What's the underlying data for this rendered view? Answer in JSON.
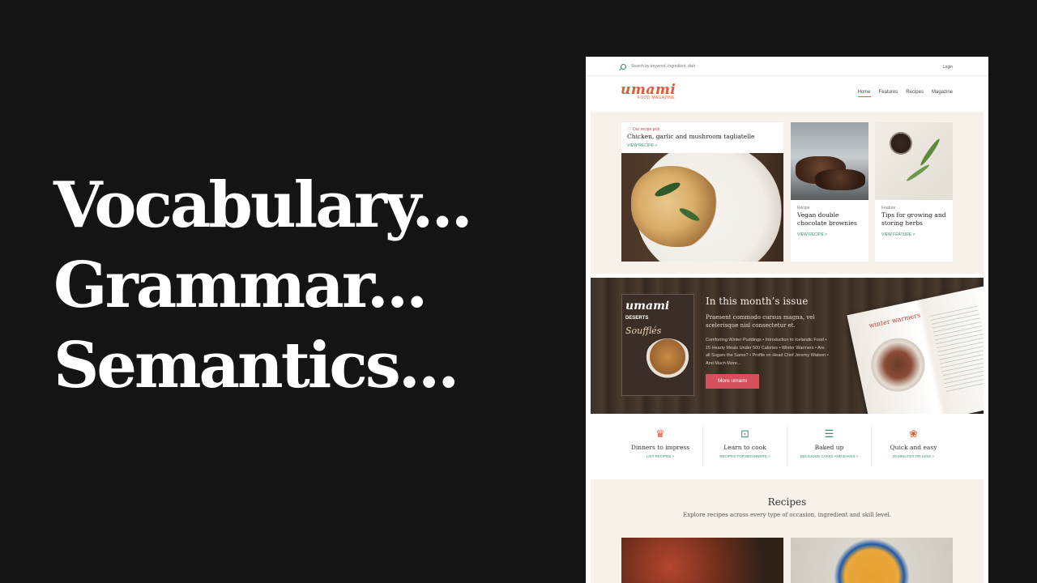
{
  "slide": {
    "lines": [
      "Vocabulary...",
      "Grammar...",
      "Semantics..."
    ]
  },
  "site": {
    "search_placeholder": "Search by keyword, ingredient, dish",
    "login": "Login",
    "logo": "umami",
    "logo_sub": "FOOD MAGAZINE",
    "nav": [
      "Home",
      "Features",
      "Recipes",
      "Magazine"
    ],
    "hero": {
      "pick_label": "Our recipe pick",
      "pick_title": "Chicken, garlic and mushroom tagliatelle",
      "pick_link": "VIEW RECIPE >",
      "cards": [
        {
          "kicker": "Recipe",
          "title": "Vegan double chocolate brownies",
          "link": "VIEW RECIPE >"
        },
        {
          "kicker": "Feature",
          "title": "Tips for growing and storing herbs",
          "link": "VIEW FEATURE >"
        }
      ]
    },
    "issue": {
      "cover_logo": "umami",
      "cover_deserts": "DESERTS",
      "cover_souffles": "Soufflés",
      "title": "In this month’s issue",
      "lede": "Praesent commodo cursus magna, vel scelerisque nisl consectetur et.",
      "contents": "Comforting Winter Puddings • Introduction to Icelandic Food • 15 Hearty Meals Under 500 Calories • Winter Warmers • Are all Sugars the Same? • Profile on Head Chef Jeremy Watson • And Much More...",
      "button": "More umami",
      "spread_headline": "winter warmers"
    },
    "categories": [
      {
        "icon": "chef-hat-icon",
        "title": "Dinners to impress",
        "link": "LIST RECIPES >"
      },
      {
        "icon": "lock-icon",
        "title": "Learn to cook",
        "link": "RECIPES FOR BEGINNERS >"
      },
      {
        "icon": "cake-icon",
        "title": "Baked up",
        "link": "DELICIOUS CAKES AND BAKES >"
      },
      {
        "icon": "lotus-icon",
        "title": "Quick and easy",
        "link": "20 MINUTES OR LESS >"
      }
    ],
    "recipes": {
      "title": "Recipes",
      "subtitle": "Explore recipes across every type of occasion, ingredient and skill level."
    }
  },
  "colors": {
    "background": "#141414",
    "brand": "#e05a3a",
    "link_green": "#3a8f6a",
    "cream": "#f8f1ea",
    "button": "#d4505a"
  }
}
